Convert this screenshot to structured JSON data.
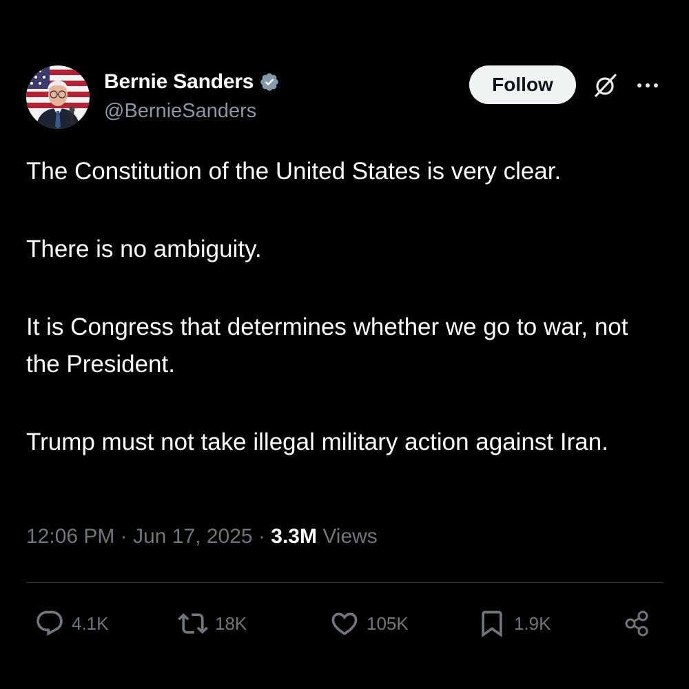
{
  "author": {
    "display_name": "Bernie Sanders",
    "handle": "@BernieSanders",
    "verified": true,
    "avatar": "profile-photo-american-flag-background"
  },
  "header": {
    "follow_label": "Follow",
    "grok_icon": "grok-icon",
    "more_icon": "more-dots-icon"
  },
  "tweet": {
    "paragraphs": [
      "The Constitution of the United States is very clear.",
      "There is no ambiguity.",
      "It is Congress that determines whether we go to war, not the President.",
      "Trump must not take illegal military action against Iran."
    ],
    "time": "12:06 PM",
    "separator": "·",
    "date": "Jun 17, 2025",
    "views_count": "3.3M",
    "views_label": "Views"
  },
  "actions": {
    "replies": "4.1K",
    "reposts": "18K",
    "likes": "105K",
    "bookmarks": "1.9K"
  },
  "colors": {
    "background": "#000000",
    "primary_text": "#ffffff",
    "secondary_text": "#71767b",
    "verified_badge": "#829aab",
    "follow_button_bg": "#eff3f4",
    "divider": "#2f3336"
  }
}
